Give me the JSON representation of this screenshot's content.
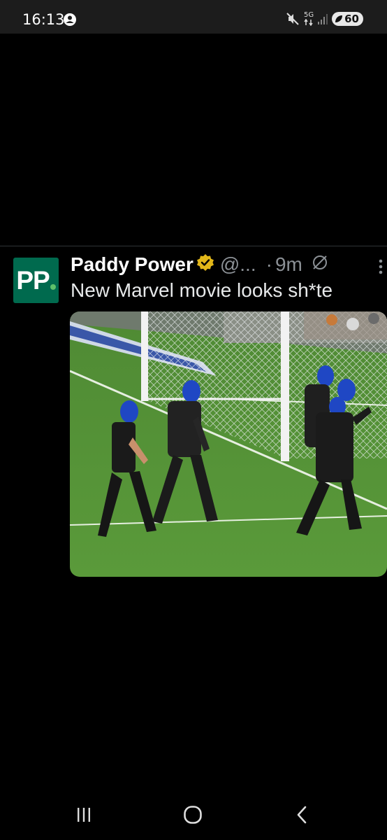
{
  "status_bar": {
    "time": "16:13",
    "network": "5G",
    "battery": "60",
    "icons": [
      "account-circle-icon",
      "mute-icon",
      "5g-data-icon",
      "signal-icon",
      "battery-saver-icon"
    ]
  },
  "post": {
    "author": {
      "name": "Paddy Power",
      "handle": "@...",
      "avatar_text": "PP",
      "verified": true,
      "avatar_color": "#006a4e",
      "verified_color": "#e2b719"
    },
    "separator": "·",
    "timestamp": "9m",
    "text": "New Marvel movie looks sh*te",
    "media_type": "video-still",
    "media_description_icon": "football-pitch-photo"
  },
  "nav_bar": {
    "buttons": [
      "recent-apps-icon",
      "home-icon",
      "back-icon"
    ]
  },
  "colors": {
    "background": "#000000",
    "status_bar": "#1c1c1c",
    "text_primary": "#e7e9ea",
    "text_secondary": "#8b9095",
    "divider": "#2f3336"
  }
}
